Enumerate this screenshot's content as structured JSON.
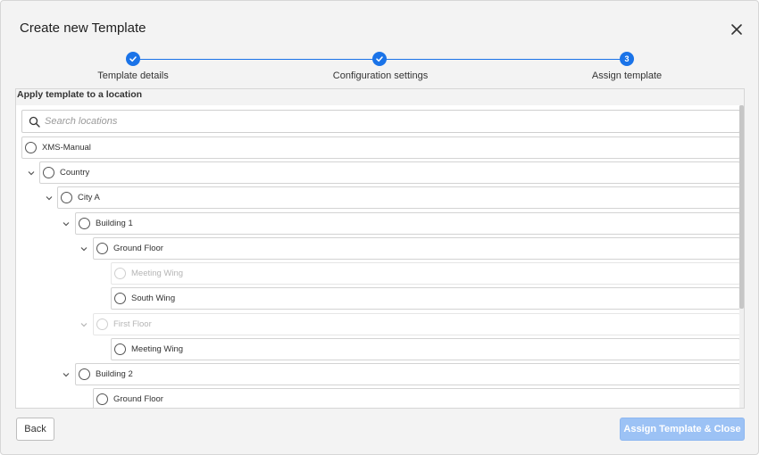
{
  "dialog": {
    "title": "Create new Template",
    "close_icon": "close-icon"
  },
  "stepper": {
    "steps": [
      {
        "label": "Template details",
        "state": "completed",
        "icon": "check-icon"
      },
      {
        "label": "Configuration settings",
        "state": "completed",
        "icon": "check-icon"
      },
      {
        "label": "Assign template",
        "state": "current",
        "number": "3"
      }
    ],
    "accent_color": "#1a73e8"
  },
  "panel": {
    "heading": "Apply template to a location",
    "search": {
      "placeholder": "Search locations",
      "value": "",
      "icon": "search-icon"
    },
    "tree": [
      {
        "label": "XMS-Manual",
        "expanded": null,
        "disabled": false
      },
      {
        "label": "Country",
        "expanded": true,
        "disabled": false
      },
      {
        "label": "City A",
        "expanded": true,
        "disabled": false
      },
      {
        "label": "Building 1",
        "expanded": true,
        "disabled": false
      },
      {
        "label": "Ground Floor",
        "expanded": true,
        "disabled": false
      },
      {
        "label": "Meeting Wing",
        "expanded": null,
        "disabled": true
      },
      {
        "label": "South Wing",
        "expanded": null,
        "disabled": false
      },
      {
        "label": "First Floor",
        "expanded": true,
        "disabled": true
      },
      {
        "label": "Meeting Wing",
        "expanded": null,
        "disabled": false
      },
      {
        "label": "Building 2",
        "expanded": true,
        "disabled": false
      },
      {
        "label": "Ground Floor",
        "expanded": null,
        "disabled": false
      }
    ]
  },
  "footer": {
    "back_label": "Back",
    "assign_label": "Assign Template & Close",
    "assign_enabled": false
  }
}
